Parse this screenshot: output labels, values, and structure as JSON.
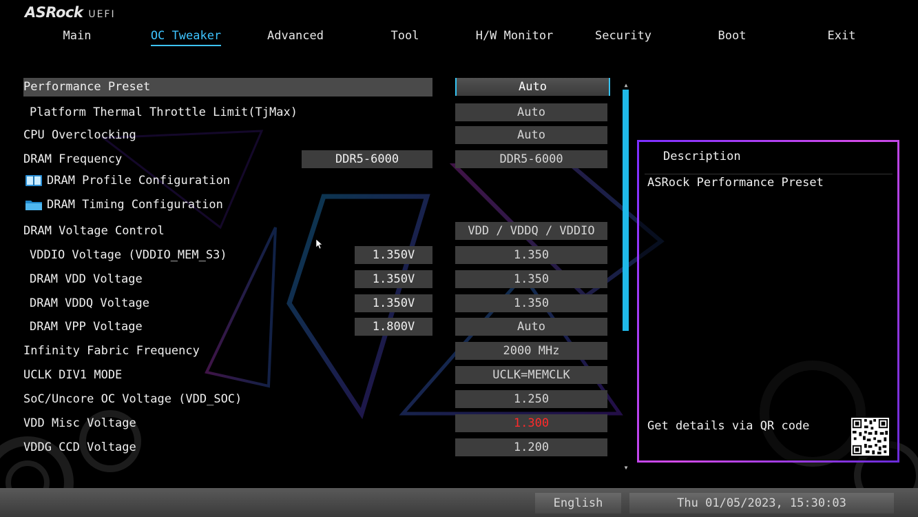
{
  "logo": {
    "brand": "ASRock",
    "sub": "UEFI"
  },
  "nav": {
    "tabs": [
      {
        "label": "Main"
      },
      {
        "label": "OC Tweaker"
      },
      {
        "label": "Advanced"
      },
      {
        "label": "Tool"
      },
      {
        "label": "H/W Monitor"
      },
      {
        "label": "Security"
      },
      {
        "label": "Boot"
      },
      {
        "label": "Exit"
      }
    ],
    "active": "OC Tweaker"
  },
  "settings": {
    "performance_preset": {
      "label": "Performance Preset",
      "value": "Auto"
    },
    "thermal_limit": {
      "label": "Platform Thermal Throttle Limit(TjMax)",
      "value": "Auto"
    },
    "cpu_overclocking": {
      "label": "CPU Overclocking",
      "value": "Auto"
    },
    "dram_frequency": {
      "label": "DRAM Frequency",
      "current": "DDR5-6000",
      "value": "DDR5-6000"
    },
    "dram_profile": {
      "label": "DRAM Profile Configuration"
    },
    "dram_timing": {
      "label": "DRAM Timing Configuration"
    },
    "dram_voltage_control": {
      "label": "DRAM Voltage Control",
      "value": "VDD / VDDQ / VDDIO"
    },
    "vddio_voltage": {
      "label": "VDDIO Voltage (VDDIO_MEM_S3)",
      "current": "1.350V",
      "value": "1.350"
    },
    "dram_vdd": {
      "label": "DRAM VDD Voltage",
      "current": "1.350V",
      "value": "1.350"
    },
    "dram_vddq": {
      "label": "DRAM VDDQ Voltage",
      "current": "1.350V",
      "value": "1.350"
    },
    "dram_vpp": {
      "label": "DRAM VPP Voltage",
      "current": "1.800V",
      "value": "Auto"
    },
    "infinity_fabric": {
      "label": "Infinity Fabric Frequency",
      "value": "2000 MHz"
    },
    "uclk_div1": {
      "label": "UCLK DIV1 MODE",
      "value": "UCLK=MEMCLK"
    },
    "soc_voltage": {
      "label": "SoC/Uncore OC Voltage (VDD_SOC)",
      "value": "1.250"
    },
    "vdd_misc": {
      "label": "VDD Misc Voltage",
      "value": "1.300"
    },
    "vddg_ccd": {
      "label": "VDDG CCD Voltage",
      "value": "1.200"
    }
  },
  "description": {
    "title": "Description",
    "text": "ASRock Performance Preset",
    "qr_text": "Get details via QR code"
  },
  "footer": {
    "language": "English",
    "datetime": "Thu 01/05/2023, 15:30:03"
  },
  "colors": {
    "accent": "#3ec4ff",
    "scrollbar": "#1fb8e8",
    "warning_value": "#ff2a2a",
    "panel_border": "#b14be8"
  }
}
